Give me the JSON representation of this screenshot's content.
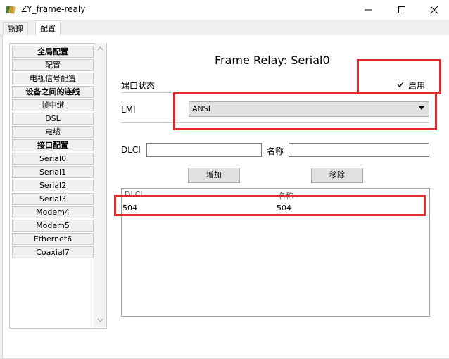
{
  "window": {
    "title": "ZY_frame-realy",
    "minimize_label": "—",
    "maximize_label": "☐",
    "close_label": "✕"
  },
  "tabs": [
    {
      "label": "物理"
    },
    {
      "label": "配置"
    }
  ],
  "sidebar": {
    "items": [
      {
        "label": "全局配置",
        "bold": true
      },
      {
        "label": "配置",
        "bold": false
      },
      {
        "label": "电视信号配置",
        "bold": false
      },
      {
        "label": "设备之间的连线",
        "bold": true
      },
      {
        "label": "帧中继",
        "bold": false
      },
      {
        "label": "DSL",
        "bold": false
      },
      {
        "label": "电缆",
        "bold": false
      },
      {
        "label": "接口配置",
        "bold": true
      },
      {
        "label": "Serial0",
        "bold": false
      },
      {
        "label": "Serial1",
        "bold": false
      },
      {
        "label": "Serial2",
        "bold": false
      },
      {
        "label": "Serial3",
        "bold": false
      },
      {
        "label": "Modem4",
        "bold": false
      },
      {
        "label": "Modem5",
        "bold": false
      },
      {
        "label": "Ethernet6",
        "bold": false
      },
      {
        "label": "Coaxial7",
        "bold": false
      }
    ]
  },
  "panel": {
    "heading": "Frame Relay: Serial0",
    "port_status_label": "端口状态",
    "enable_label": "启用",
    "enable_checked": true,
    "lmi_label": "LMI",
    "lmi_value": "ANSI",
    "dlci_label": "DLCI",
    "dlci_value": "",
    "name_label": "名称",
    "name_value": "",
    "add_button": "增加",
    "remove_button": "移除"
  },
  "table": {
    "columns": [
      "DLCI",
      "名称"
    ],
    "rows": [
      [
        "504",
        "504"
      ]
    ]
  },
  "colors": {
    "highlight_box": "#e0272b"
  }
}
